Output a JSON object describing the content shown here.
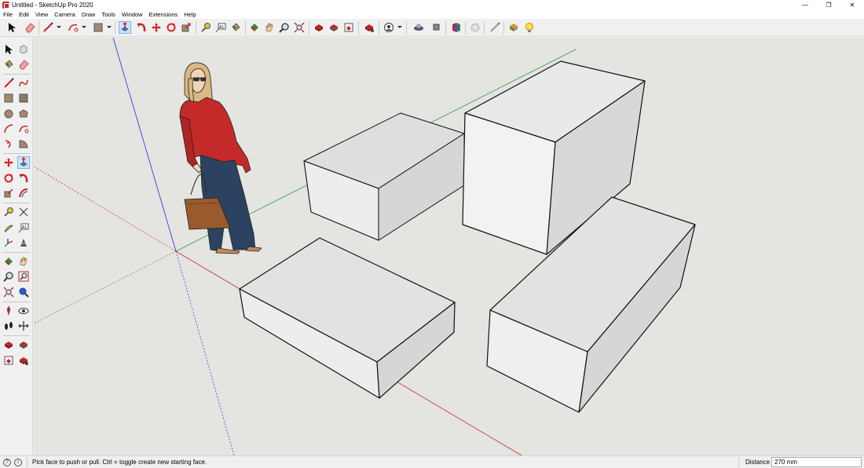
{
  "window": {
    "title": "Untitled - SketchUp Pro 2020",
    "minimize_glyph": "—",
    "restore_glyph": "❐",
    "close_glyph": "✕"
  },
  "menu": [
    "File",
    "Edit",
    "View",
    "Camera",
    "Draw",
    "Tools",
    "Window",
    "Extensions",
    "Help"
  ],
  "status": {
    "hint": "Pick face to push or pull.  Ctrl = toggle create new starting face.",
    "distance_label": "Distance",
    "distance_value": "270 mm"
  },
  "colors": {
    "viewport_bg": "#e4e4e0",
    "axis_red": "#c8283a",
    "axis_green": "#2e9e3a",
    "axis_blue": "#2a2ad8",
    "active_tool": "#cce4f7",
    "sketchup_red": "#c4262e"
  },
  "icons": {
    "toolbar": [
      "select-arrow-icon",
      "eraser-icon",
      "pencil-line-icon",
      "arc-icon",
      "rectangle-icon",
      "push-pull-icon",
      "follow-me-icon",
      "move-icon",
      "rotate-icon",
      "offset-icon",
      "tape-measure-icon",
      "text-icon",
      "paint-bucket-icon",
      "orbit-icon",
      "pan-icon",
      "zoom-icon",
      "zoom-extents-icon",
      "warehouse-icon",
      "extension-warehouse-icon",
      "layout-icon",
      "send-to-layout-icon",
      "extension-manager-icon",
      "user-icon",
      "sandbox-icon",
      "components-icon",
      "styles-icon",
      "settings-icon",
      "tag-icon",
      "section-plane-icon",
      "lightbulb-icon"
    ],
    "palette": [
      "select-arrow-icon",
      "component-icon",
      "paint-bucket-icon",
      "eraser-icon",
      "pencil-line-icon",
      "freehand-icon",
      "rectangle-icon",
      "rotated-rectangle-icon",
      "circle-icon",
      "polygon-icon",
      "arc-icon",
      "two-point-arc-icon",
      "three-point-arc-icon",
      "pie-icon",
      "move-icon",
      "push-pull-icon",
      "rotate-icon",
      "follow-me-icon",
      "scale-icon",
      "offset-icon",
      "tape-measure-icon",
      "dimension-icon",
      "protractor-icon",
      "text-icon",
      "axes-icon",
      "3d-text-icon",
      "orbit-icon",
      "pan-icon",
      "zoom-icon",
      "zoom-window-icon",
      "zoom-extents-icon",
      "search-icon",
      "position-camera-icon",
      "look-around-icon",
      "walk-icon",
      "section-plane-icon",
      "warehouse-icon",
      "extension-warehouse-icon",
      "send-to-layout-icon",
      "extension-manager-icon"
    ]
  }
}
